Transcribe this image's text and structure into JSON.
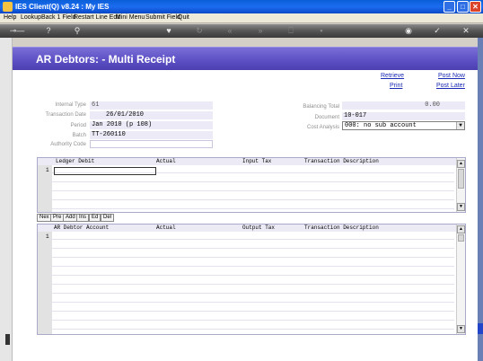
{
  "window": {
    "title": "IES Client(Q) v8.24 : My IES"
  },
  "menu": [
    "Help",
    "Lookup",
    "Back 1 Field",
    "Restart Line Edit",
    "Mini Menu",
    "Submit Field",
    "Quit"
  ],
  "header": {
    "title": "AR Debtors: - Multi Receipt"
  },
  "links": {
    "retrieve": "Retrieve",
    "post_now": "Post Now",
    "print": "Print",
    "post_later": "Post Later"
  },
  "fields": {
    "internal_type": {
      "label": "Internal Type",
      "value": "61"
    },
    "transaction_date": {
      "label": "Transaction Date",
      "value": "26/01/2010"
    },
    "period": {
      "label": "Period",
      "value": "Jan 2010 (p 108)"
    },
    "batch": {
      "label": "Batch",
      "value": "TT-260110"
    },
    "authority_code": {
      "label": "Authority Code",
      "value": ""
    },
    "balancing_total": {
      "label": "Balancing Total",
      "value": "0.00"
    },
    "document": {
      "label": "Document",
      "value": "10-017"
    },
    "cost_analysis": {
      "label": "Cost Analysis",
      "value": "000: no sub account"
    }
  },
  "grid1": {
    "columns": [
      "Ledger Debit",
      "Actual",
      "Input Tax",
      "Transaction Description"
    ],
    "first_row": "1"
  },
  "grid2": {
    "columns": [
      "AR Debtor Account",
      "Actual",
      "Output Tax",
      "Transaction Description"
    ],
    "first_row": "1"
  },
  "buttons": [
    "Nex",
    "Pre",
    "Add",
    "Ins",
    "Ed",
    "Del"
  ],
  "icons": {
    "window_minimize": "_",
    "window_maximize": "□",
    "window_close": "✕",
    "dropdown_arrow": "▼",
    "scroll_up": "▲",
    "scroll_down": "▼"
  }
}
